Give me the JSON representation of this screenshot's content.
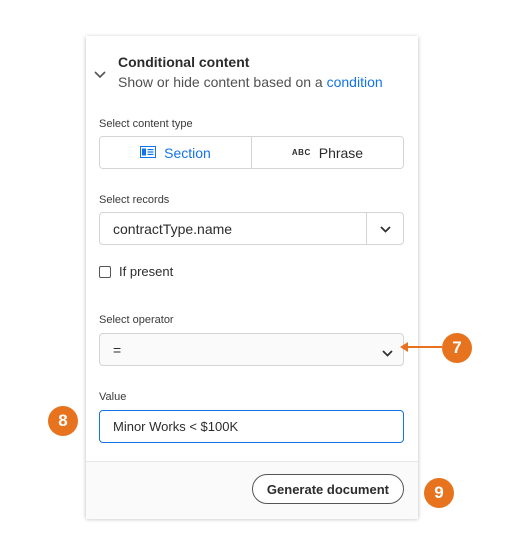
{
  "panel": {
    "title": "Conditional content",
    "subtitle_prefix": "Show or hide content based on a ",
    "subtitle_link": "condition",
    "content_type": {
      "label": "Select content type",
      "options": [
        {
          "label": "Section",
          "icon": "section-icon",
          "selected": true
        },
        {
          "label": "Phrase",
          "icon_text": "ABC",
          "selected": false
        }
      ]
    },
    "records": {
      "label": "Select records",
      "value": "contractType.name"
    },
    "if_present": {
      "label": "If present",
      "checked": false
    },
    "operator": {
      "label": "Select operator",
      "value": "="
    },
    "value_field": {
      "label": "Value",
      "value": "Minor Works < $100K"
    },
    "generate_button": "Generate document"
  },
  "callouts": {
    "operator": "7",
    "value": "8",
    "generate": "9"
  },
  "colors": {
    "accent": "#1473e6",
    "callout": "#e8731f"
  }
}
